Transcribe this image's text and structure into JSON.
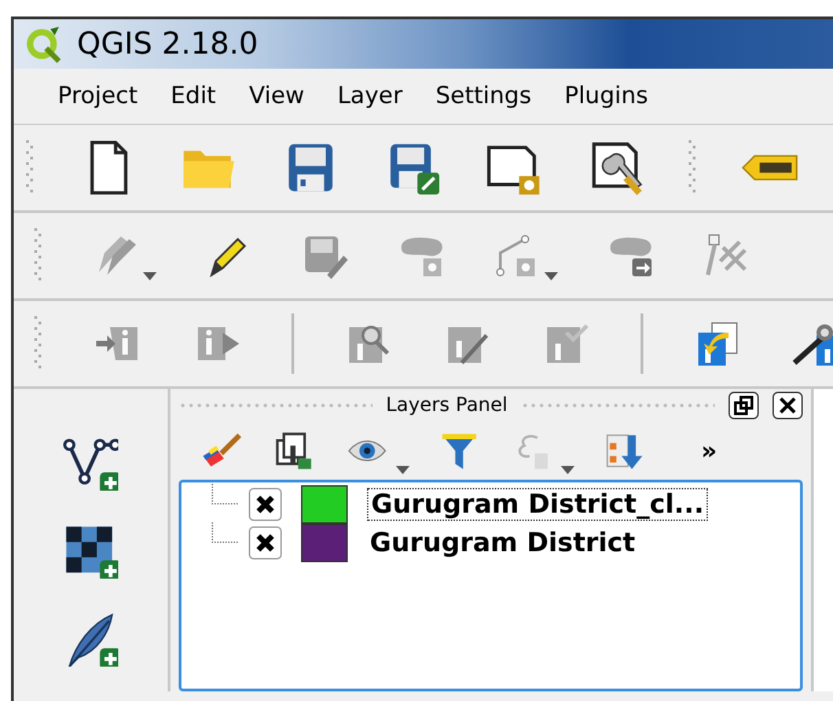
{
  "window": {
    "title": "QGIS 2.18.0"
  },
  "menu": [
    "Project",
    "Edit",
    "View",
    "Layer",
    "Settings",
    "Plugins"
  ],
  "toolbars": [
    [
      {
        "kind": "new"
      },
      {
        "kind": "open"
      },
      {
        "kind": "save"
      },
      {
        "kind": "saveas"
      },
      {
        "kind": "composer"
      },
      {
        "kind": "composer-manager"
      },
      {
        "kind": "grip"
      },
      {
        "kind": "label"
      }
    ],
    [
      {
        "kind": "pencils",
        "disabled": true,
        "dropdown": true
      },
      {
        "kind": "pencil",
        "disabled": false
      },
      {
        "kind": "save-edits",
        "disabled": true
      },
      {
        "kind": "add-shape",
        "disabled": true
      },
      {
        "kind": "node",
        "disabled": true,
        "dropdown": true
      },
      {
        "kind": "move-shape",
        "disabled": true
      },
      {
        "kind": "node-tool",
        "disabled": true
      }
    ],
    [
      {
        "kind": "info-in",
        "disabled": true
      },
      {
        "kind": "info-out",
        "disabled": true
      },
      {
        "kind": "separator"
      },
      {
        "kind": "info-search",
        "disabled": true
      },
      {
        "kind": "info-edit",
        "disabled": true
      },
      {
        "kind": "info-check",
        "disabled": true
      },
      {
        "kind": "separator"
      },
      {
        "kind": "metadata",
        "disabled": false
      },
      {
        "kind": "metadata-wrench",
        "disabled": false
      }
    ]
  ],
  "side_toolbar": [
    {
      "kind": "add-vector"
    },
    {
      "kind": "add-raster"
    },
    {
      "kind": "add-text"
    }
  ],
  "layers_panel": {
    "title": "Layers Panel",
    "toolbar": [
      {
        "kind": "brush",
        "disabled": false
      },
      {
        "kind": "add-group",
        "disabled": false
      },
      {
        "kind": "eye",
        "disabled": false,
        "dropdown": true
      },
      {
        "kind": "filter",
        "disabled": false
      },
      {
        "kind": "epsilon",
        "disabled": true,
        "dropdown": true
      },
      {
        "kind": "order",
        "disabled": false
      }
    ],
    "overflow": "»",
    "layers": [
      {
        "name": "Gurugram District_cl...",
        "checked": true,
        "color": "#22cc22",
        "selected": true
      },
      {
        "name": "Gurugram District",
        "checked": true,
        "color": "#5c1f78",
        "selected": false
      }
    ]
  }
}
